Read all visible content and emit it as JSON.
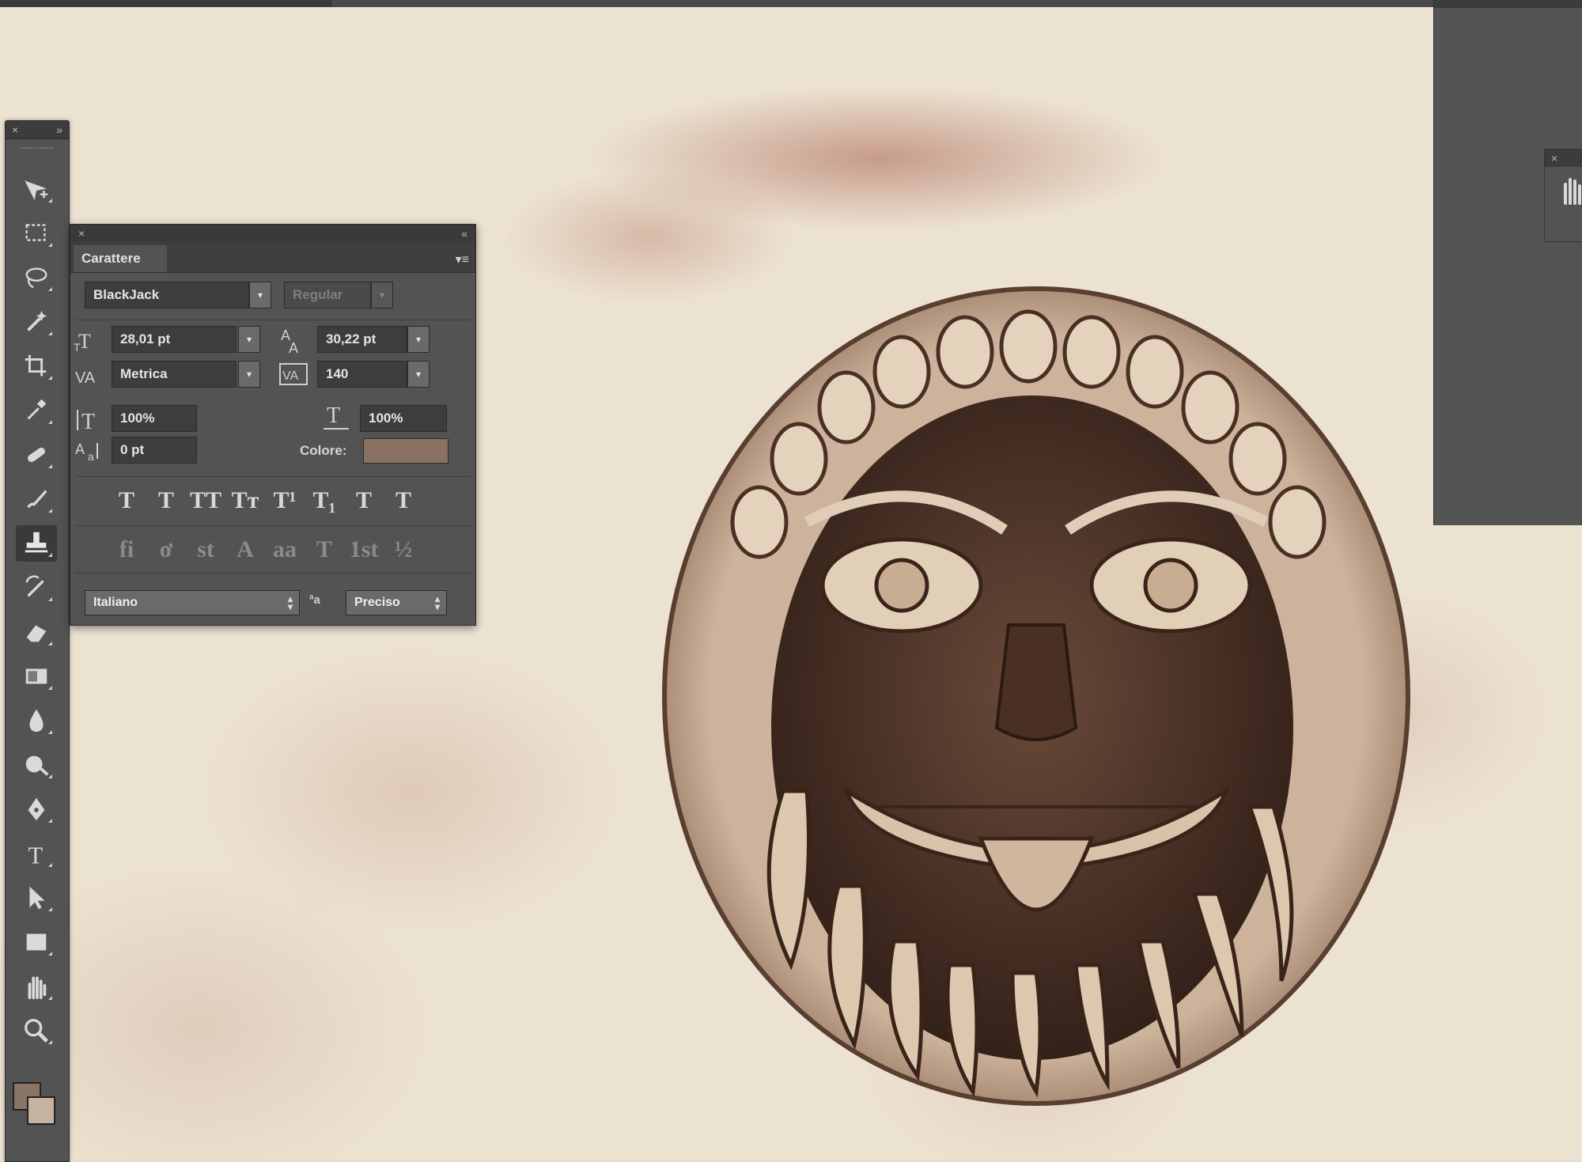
{
  "toolbar": {
    "close_glyph": "×",
    "collapse_glyph": "»",
    "tools": [
      {
        "icon": "move-tool-icon"
      },
      {
        "icon": "marquee-tool-icon"
      },
      {
        "icon": "lasso-tool-icon"
      },
      {
        "icon": "magic-wand-tool-icon"
      },
      {
        "icon": "crop-tool-icon"
      },
      {
        "icon": "eyedropper-tool-icon"
      },
      {
        "icon": "healing-brush-tool-icon"
      },
      {
        "icon": "brush-tool-icon"
      },
      {
        "icon": "clone-stamp-tool-icon",
        "active": true
      },
      {
        "icon": "history-brush-tool-icon"
      },
      {
        "icon": "eraser-tool-icon"
      },
      {
        "icon": "gradient-tool-icon"
      },
      {
        "icon": "blur-tool-icon"
      },
      {
        "icon": "dodge-tool-icon"
      },
      {
        "icon": "pen-tool-icon"
      },
      {
        "icon": "type-tool-icon"
      },
      {
        "icon": "path-selection-tool-icon"
      },
      {
        "icon": "rectangle-tool-icon"
      },
      {
        "icon": "hand-tool-icon"
      },
      {
        "icon": "zoom-tool-icon"
      }
    ],
    "foreground_color": "#8a7466",
    "background_color": "#c7b3a2"
  },
  "character_panel": {
    "close_glyph": "×",
    "collapse_glyph": "«",
    "tab_label": "Carattere",
    "menu_glyph": "▾≡",
    "font_family": "BlackJack",
    "font_style": "Regular",
    "font_size": "28,01 pt",
    "leading": "30,22 pt",
    "kerning": "Metrica",
    "tracking": "140",
    "vertical_scale": "100%",
    "horizontal_scale": "100%",
    "baseline_shift": "0 pt",
    "color_label": "Colore:",
    "text_color": "#8a7262",
    "style_buttons": [
      "T",
      "T",
      "TT",
      "Tт",
      "T¹",
      "T₁",
      "T",
      "T"
    ],
    "opentype_buttons": [
      "fi",
      "ơ",
      "st",
      "A",
      "aa",
      "T",
      "1st",
      "½"
    ],
    "language": "Italiano",
    "aa_glyph": "ªa",
    "anti_aliasing": "Preciso"
  }
}
